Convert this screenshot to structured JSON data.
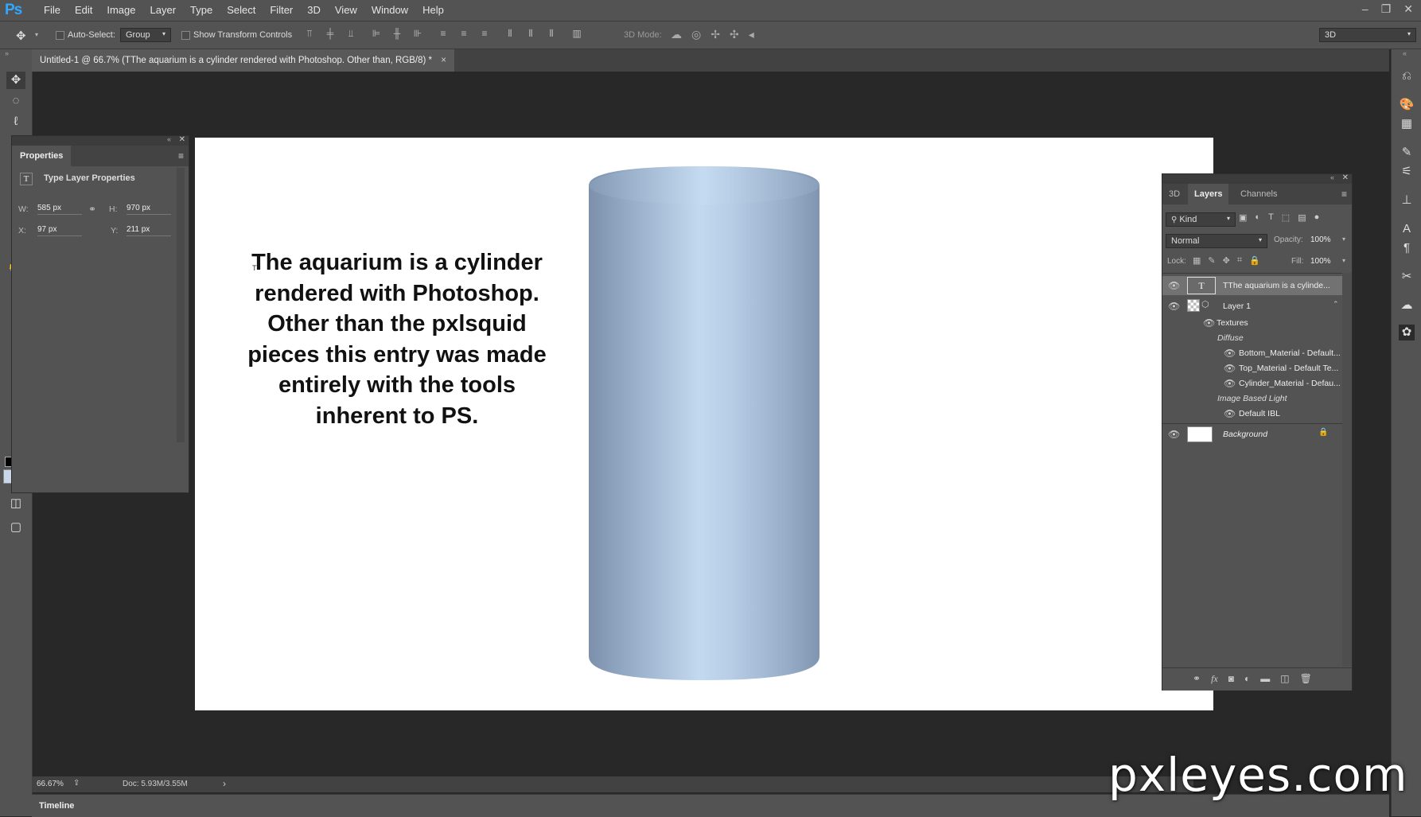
{
  "app": {
    "logo": "Ps"
  },
  "menu": [
    "File",
    "Edit",
    "Image",
    "Layer",
    "Type",
    "Select",
    "Filter",
    "3D",
    "View",
    "Window",
    "Help"
  ],
  "window_controls": {
    "minimize": "–",
    "restore": "❐",
    "close": "✕"
  },
  "options_bar": {
    "auto_select_label": "Auto-Select:",
    "auto_select_value": "Group",
    "show_transform_label": "Show Transform Controls",
    "mode_3d_label": "3D Mode:",
    "workspace_value": "3D"
  },
  "document_tab": {
    "title": "Untitled-1 @ 66.7% (TThe aquarium is a cylinder rendered with Photoshop. Other than, RGB/8) *",
    "close": "×"
  },
  "canvas": {
    "text_lines": [
      "The aquarium is a cylinder",
      "rendered with Photoshop.",
      "Other than the pxlsquid",
      "pieces this entry was made",
      "entirely with the tools",
      "inherent to PS."
    ],
    "text_cursor": "T",
    "cylinder_colors": {
      "edge": "#7f93ae",
      "mid": "#a9bfd8",
      "highlight": "#c6dcf2"
    }
  },
  "properties": {
    "tab": "Properties",
    "section_title": "Type Layer Properties",
    "type_icon": "T",
    "w_label": "W:",
    "w_value": "585 px",
    "h_label": "H:",
    "h_value": "970 px",
    "x_label": "X:",
    "x_value": "97 px",
    "y_label": "Y:",
    "y_value": "211 px"
  },
  "layers_panel": {
    "tabs": [
      "3D",
      "Layers",
      "Channels"
    ],
    "kind_label": "Kind",
    "blend_mode": "Normal",
    "opacity_label": "Opacity:",
    "opacity_value": "100%",
    "lock_label": "Lock:",
    "fill_label": "Fill:",
    "fill_value": "100%",
    "layers": [
      {
        "name": "TThe aquarium is a cylinde...",
        "thumb": "T"
      },
      {
        "name": "Layer 1"
      }
    ],
    "textures_label": "Textures",
    "diffuse_label": "Diffuse",
    "materials": [
      "Bottom_Material - Default...",
      "Top_Material - Default Te...",
      "Cylinder_Material - Defau..."
    ],
    "ibl_label": "Image Based Light",
    "ibl_item": "Default IBL",
    "background_label": "Background",
    "bottom_icons": [
      "link",
      "fx",
      "mask",
      "adjust",
      "folder",
      "new",
      "trash"
    ],
    "fx_label": "fx"
  },
  "status": {
    "zoom": "66.67%",
    "doc": "Doc: 5.93M/3.55M",
    "arrow": "›"
  },
  "timeline": {
    "label": "Timeline"
  },
  "watermark": "pxleyes.com"
}
